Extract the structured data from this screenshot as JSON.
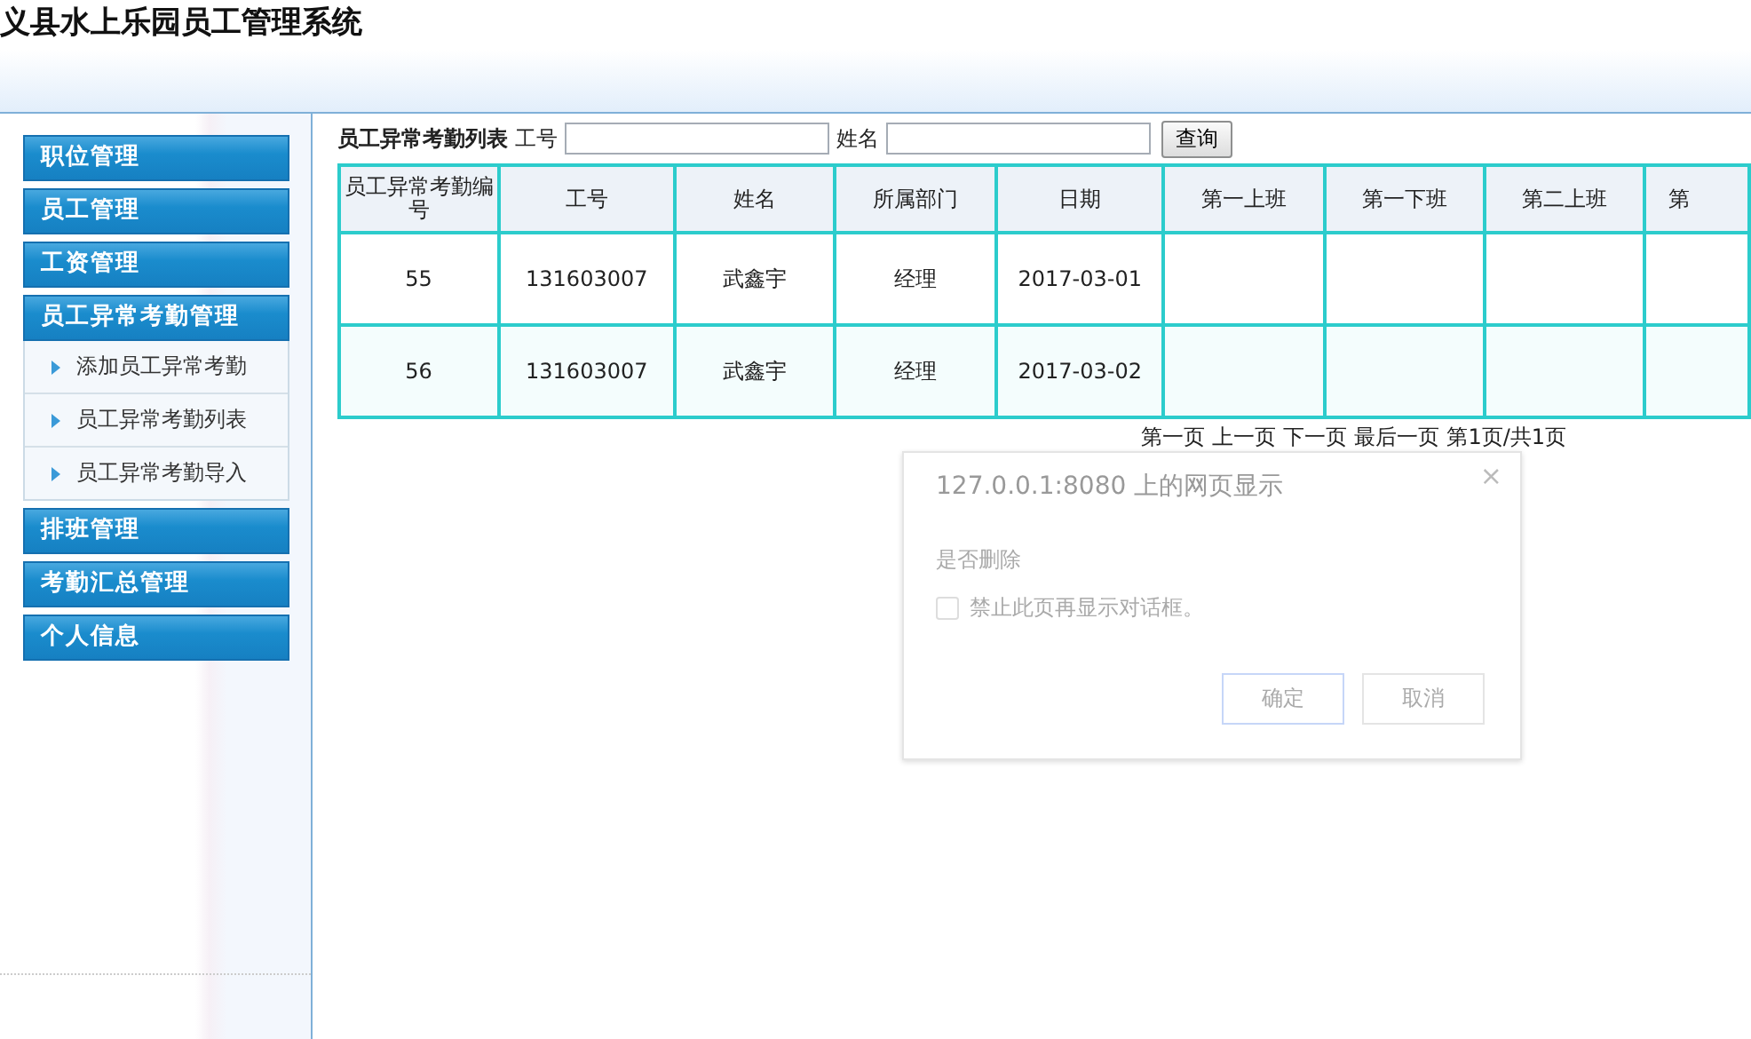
{
  "app_title": "义县水上乐园员工管理系统",
  "sidebar": {
    "items": [
      {
        "label": "职位管理"
      },
      {
        "label": "员工管理"
      },
      {
        "label": "工资管理"
      },
      {
        "label": "员工异常考勤管理",
        "children": [
          {
            "label": "添加员工异常考勤"
          },
          {
            "label": "员工异常考勤列表"
          },
          {
            "label": "员工异常考勤导入"
          }
        ]
      },
      {
        "label": "排班管理"
      },
      {
        "label": "考勤汇总管理"
      },
      {
        "label": "个人信息"
      }
    ]
  },
  "search": {
    "title": "员工异常考勤列表",
    "fields": [
      {
        "label": "工号"
      },
      {
        "label": "姓名"
      }
    ],
    "button": "查询"
  },
  "table": {
    "columns": [
      "员工异常考勤编号",
      "工号",
      "姓名",
      "所属部门",
      "日期",
      "第一上班",
      "第一下班",
      "第二上班",
      "第"
    ],
    "rows": [
      [
        "55",
        "131603007",
        "武鑫宇",
        "经理",
        "2017-03-01",
        "",
        "",
        "",
        ""
      ],
      [
        "56",
        "131603007",
        "武鑫宇",
        "经理",
        "2017-03-02",
        "",
        "",
        "",
        ""
      ]
    ]
  },
  "pagination": [
    "第一页",
    "上一页",
    "下一页",
    "最后一页",
    "第1页/共1页"
  ],
  "dialog": {
    "title": "127.0.0.1:8080 上的网页显示",
    "close": "×",
    "message": "是否删除",
    "checkbox": {
      "label": "禁止此页再显示对话框。",
      "checked": false
    },
    "buttons": [
      "确定",
      "取消"
    ]
  }
}
